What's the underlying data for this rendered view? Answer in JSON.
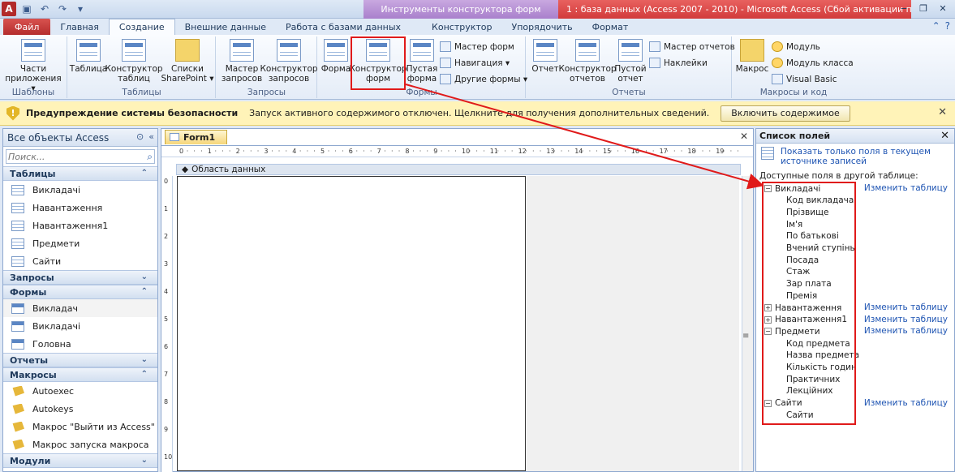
{
  "titlebar": {
    "app_icon_letter": "A",
    "context_title": "Инструменты конструктора форм",
    "window_title": "1 : база данных (Access 2007 - 2010)  -  Microsoft Access (Сбой активации продукта)",
    "controls": [
      "−",
      "❐",
      "✕"
    ]
  },
  "tabs": [
    {
      "label": "Файл"
    },
    {
      "label": "Главная"
    },
    {
      "label": "Создание"
    },
    {
      "label": "Внешние данные"
    },
    {
      "label": "Работа с базами данных"
    },
    {
      "label": "Конструктор"
    },
    {
      "label": "Упорядочить"
    },
    {
      "label": "Формат"
    }
  ],
  "ribbon": {
    "templates": {
      "label": "Шаблоны",
      "parts": "Части приложения ▾"
    },
    "tables": {
      "label": "Таблицы",
      "table": "Таблица",
      "designer": "Конструктор таблиц",
      "sharepoint": "Списки SharePoint ▾"
    },
    "queries": {
      "label": "Запросы",
      "wizard": "Мастер запросов",
      "designer": "Конструктор запросов"
    },
    "forms": {
      "label": "Формы",
      "form": "Форма",
      "designer": "Конструктор форм",
      "blank": "Пустая форма",
      "wizard": "Мастер форм",
      "navigation": "Навигация ▾",
      "other": "Другие формы ▾"
    },
    "reports": {
      "label": "Отчеты",
      "report": "Отчет",
      "designer": "Конструктор отчетов",
      "blank": "Пустой отчет",
      "wizard": "Мастер отчетов",
      "labels": "Наклейки"
    },
    "macros": {
      "label": "Макросы и код",
      "macro": "Макрос",
      "module": "Модуль",
      "class_module": "Модуль класса",
      "vba": "Visual Basic"
    }
  },
  "security": {
    "title": "Предупреждение системы безопасности",
    "text": "Запуск активного содержимого отключен. Щелкните для получения дополнительных сведений.",
    "button": "Включить содержимое"
  },
  "nav": {
    "title": "Все объекты Access",
    "search_placeholder": "Поиск...",
    "categories": {
      "tables": {
        "label": "Таблицы",
        "items": [
          "Викладачі",
          "Навантаження",
          "Навантаження1",
          "Предмети",
          "Сайти"
        ]
      },
      "queries": {
        "label": "Запросы"
      },
      "forms": {
        "label": "Формы",
        "items": [
          "Викладач",
          "Викладачі",
          "Головна"
        ]
      },
      "reports": {
        "label": "Отчеты"
      },
      "macros": {
        "label": "Макросы",
        "items": [
          "Autoexec",
          "Autokeys",
          "Макрос \"Выйти из Access\"",
          "Макрос запуска макроса"
        ]
      },
      "modules": {
        "label": "Модули"
      }
    }
  },
  "document": {
    "tab": "Form1",
    "section": "Область данных"
  },
  "fieldlist": {
    "title": "Список полей",
    "show_only": "Показать только поля в текущем источнике записей",
    "available": "Доступные поля в другой таблице:",
    "edit_table": "Изменить таблицу",
    "tables": [
      {
        "name": "Викладачі",
        "expanded": true,
        "fields": [
          "Код викладача",
          "Прізвище",
          "Ім'я",
          "По батькові",
          "Вчений ступінь",
          "Посада",
          "Стаж",
          "Зар плата",
          "Премія"
        ]
      },
      {
        "name": "Навантаження",
        "expanded": false,
        "fields": []
      },
      {
        "name": "Навантаження1",
        "expanded": false,
        "fields": []
      },
      {
        "name": "Предмети",
        "expanded": true,
        "fields": [
          "Код предмета",
          "Назва предмета",
          "Кількість годин",
          "Практичних",
          "Лекційних"
        ]
      },
      {
        "name": "Сайти",
        "expanded": true,
        "fields": [
          "Сайти"
        ]
      }
    ]
  },
  "colors": {
    "accent": "#e01a1a",
    "context": "#a980cc",
    "title": "#d23b3b",
    "warning_bg": "#fff3b8",
    "link": "#1f55b3"
  }
}
